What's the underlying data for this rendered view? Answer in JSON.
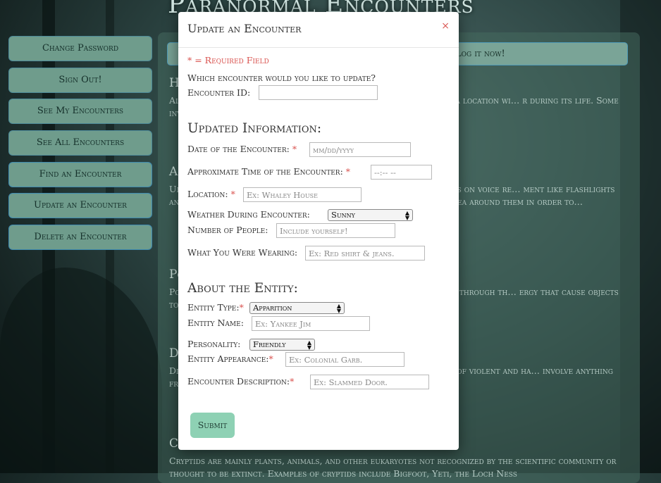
{
  "site": {
    "title": "Paranormal Encounters"
  },
  "nav": {
    "items": [
      "Change Password",
      "Sign Out!",
      "See My Encounters",
      "See All Encounters",
      "Find an Encounter",
      "Update an Encounter",
      "Delete an Encounter"
    ]
  },
  "main": {
    "log_bar": "Log it now!",
    "sections": [
      {
        "heading": "H",
        "text": "Al … type of entity appears to be a re… hauntings usually exist in a location wi… r during its life. Some investigators be… t space and remains long after the pe…"
      },
      {
        "heading": "A",
        "text": "Ui… with people in the living world. Sp… objects, answer questions on voice re… ment like flashlights and EMF (E… e hypothesis states spirits are made ui… ut of the area around them in order to…"
      },
      {
        "heading": "Po",
        "text": "Po… ctivity that can be attributed to ei… n their own. This occurs through th… ergy that cause objects to move, do…"
      },
      {
        "heading": "D",
        "text": "Di… mmanded by Satan himself. Evidence fr… ases suggest a form of violent and ha… involve anything from objects fl… ces. People have even reported being pi…"
      },
      {
        "heading": "C",
        "text": "Cryptids are mainly plants, animals, and other eukaryotes not recognized by the scientific community or thought to be extinct. Examples of cryptids include Bigfoot, Yeti, the Loch Ness"
      }
    ]
  },
  "modal": {
    "title": "Update an Encounter",
    "close": "×",
    "required_note": "* = Required Field",
    "question": "Which encounter would you like to update?",
    "encounter_id_label": "Encounter ID:",
    "updated_heading": "Updated Information:",
    "date_label": "Date of the Encounter:",
    "date_placeholder": "mm/dd/yyyy",
    "time_label": "Approximate Time of the Encounter:",
    "time_placeholder": "--:-- --",
    "location_label": "Location:",
    "location_placeholder": "Ex: Whaley House",
    "weather_label": "Weather During Encounter:",
    "weather_value": "Sunny",
    "people_label": "Number of People:",
    "people_placeholder": "Include yourself!",
    "wearing_label": "What You Were Wearing:",
    "wearing_placeholder": "Ex: Red shirt & jeans.",
    "entity_heading": "About the Entity:",
    "entity_type_label": "Entity Type:",
    "entity_type_value": "Apparition",
    "entity_name_label": "Entity Name:",
    "entity_name_placeholder": "Ex: Yankee Jim",
    "personality_label": "Personality:",
    "personality_value": "Friendly",
    "appearance_label": "Entity Appearance:",
    "appearance_placeholder": "Ex: Colonial Garb.",
    "description_label": "Encounter Description:",
    "description_placeholder": "Ex: Slammed Door.",
    "submit": "Submit",
    "star": "*"
  },
  "colors": {
    "required": "#d9534f",
    "nav_bg": "#6f9c8c",
    "submit_bg": "#8ed1b4"
  }
}
